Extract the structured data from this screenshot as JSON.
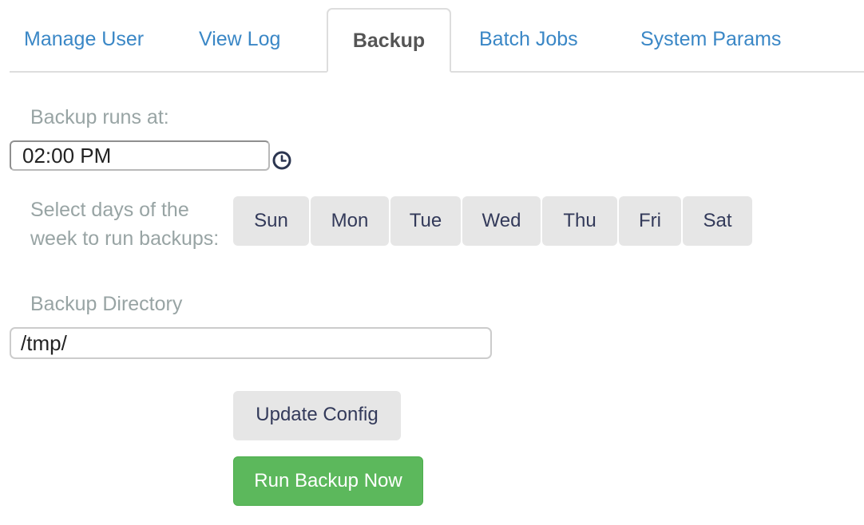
{
  "tabs": [
    {
      "label": "Manage User",
      "active": false
    },
    {
      "label": "View Log",
      "active": false
    },
    {
      "label": "Backup",
      "active": true
    },
    {
      "label": "Batch Jobs",
      "active": false
    },
    {
      "label": "System Params",
      "active": false
    }
  ],
  "form": {
    "time_label": "Backup runs at:",
    "time_value": "02:00 PM",
    "time_icon": "clock-icon",
    "days_label": "Select days of the week to run backups:",
    "days": [
      "Sun",
      "Mon",
      "Tue",
      "Wed",
      "Thu",
      "Fri",
      "Sat"
    ],
    "dir_label": "Backup Directory",
    "dir_value": "/tmp/"
  },
  "actions": {
    "update_label": "Update Config",
    "run_label": "Run Backup Now"
  },
  "colors": {
    "link": "#3a87c6",
    "label": "#98a4a4",
    "button_gray": "#e6e6e6",
    "button_green": "#5cb85c"
  }
}
